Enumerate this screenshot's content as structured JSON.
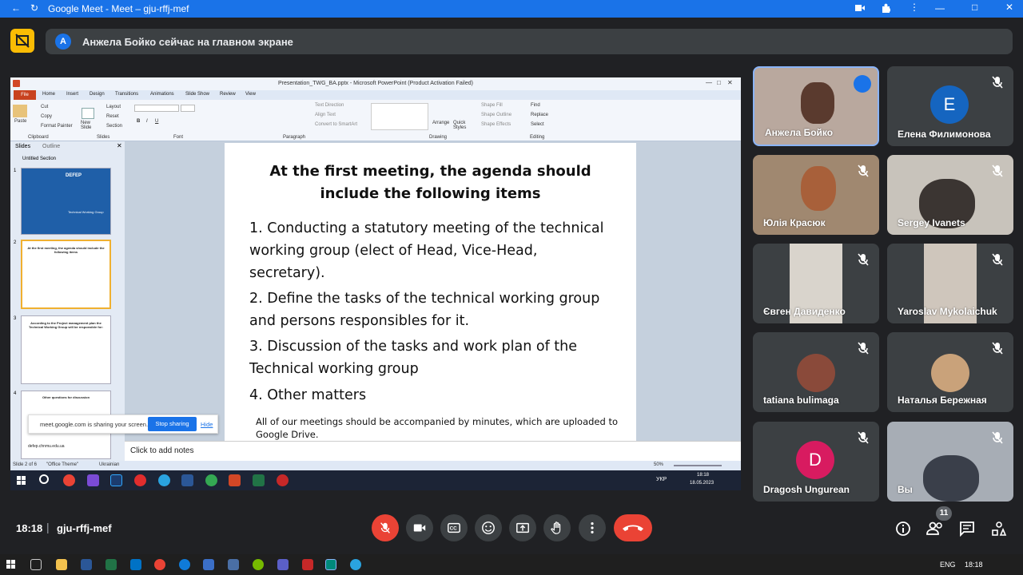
{
  "browser": {
    "window_title": "Google Meet - Meet – gju-rffj-mef"
  },
  "banner": {
    "avatar_letter": "A",
    "text": "Анжела Бойко сейчас на главном экране"
  },
  "powerpoint": {
    "title": "Presentation_TWG_BA.pptx - Microsoft PowerPoint (Product Activation Failed)",
    "file_tab": "File",
    "tabs": [
      "Home",
      "Insert",
      "Design",
      "Transitions",
      "Animations",
      "Slide Show",
      "Review",
      "View"
    ],
    "ribbon": {
      "paste": "Paste",
      "cut": "Cut",
      "copy": "Copy",
      "format_painter": "Format Painter",
      "clipboard": "Clipboard",
      "new_slide": "New Slide",
      "layout": "Layout",
      "reset": "Reset",
      "section": "Section",
      "slides": "Slides",
      "font": "Font",
      "paragraph": "Paragraph",
      "text_direction": "Text Direction",
      "align_text": "Align Text",
      "convert_smartart": "Convert to SmartArt",
      "arrange": "Arrange",
      "quick_styles": "Quick Styles",
      "shape_fill": "Shape Fill",
      "shape_outline": "Shape Outline",
      "shape_effects": "Shape Effects",
      "drawing": "Drawing",
      "find": "Find",
      "replace": "Replace",
      "select": "Select",
      "editing": "Editing"
    },
    "panel_tabs": [
      "Slides",
      "Outline"
    ],
    "section_name": "Untitled Section",
    "thumbnails": [
      {
        "num": "1",
        "title": "DEFEP",
        "subtitle": "Technical Working Group"
      },
      {
        "num": "2",
        "title": "At the first meeting, the agenda should include the following items"
      },
      {
        "num": "3",
        "title": "According to the Project management plan the Technical Working Group will be responsible for:"
      },
      {
        "num": "4",
        "title": "Other questions for discussion"
      }
    ],
    "slide": {
      "title": "At the first meeting, the agenda should include the following items",
      "items": [
        "1. Conducting a statutory meeting of the technical working group (elect of Head, Vice-Head, secretary).",
        "2. Define the tasks of the technical working group and persons responsibles for it.",
        "3. Discussion of the tasks and work plan of the Technical working group",
        "4. Other matters"
      ],
      "footnote": "All of our meetings should be accompanied by minutes, which are uploaded to Google Drive."
    },
    "notes_placeholder": "Click to add notes",
    "status_slide": "Slide 2 of 6",
    "status_theme": "\"Office Theme\"",
    "status_lang": "Ukrainian",
    "zoom": "50%",
    "inner_clock_time": "18:18",
    "inner_clock_date": "18.05.2023",
    "inner_lang": "УКР",
    "sharing_text": "meet.google.com is sharing your screen.",
    "stop_sharing": "Stop sharing",
    "hide": "Hide",
    "tooltip_url": "defep.chnmu.edu.ua"
  },
  "participants": [
    {
      "name": "Анжела Бойко",
      "speaking": true
    },
    {
      "name": "Елена Филимонова",
      "letter": "E",
      "color": "#1565c0"
    },
    {
      "name": "Юлія Красюк"
    },
    {
      "name": "Sergey Ivanets"
    },
    {
      "name": "Євген Давиденко"
    },
    {
      "name": "Yaroslav Mykolaichuk"
    },
    {
      "name": "tatiana bulimaga"
    },
    {
      "name": "Наталья Бережная"
    },
    {
      "name": "Dragosh Ungurean",
      "letter": "D",
      "color": "#d81b60"
    },
    {
      "name": "Вы"
    }
  ],
  "meeting": {
    "time": "18:18",
    "separator": "|",
    "code": "gju-rffj-mef",
    "people_count": "11"
  },
  "os": {
    "lang": "ENG",
    "time": "18:18"
  },
  "colors": {
    "meet_bg": "#202124",
    "tile_bg": "#3c4043",
    "end_call": "#ea4335",
    "browser_bar": "#1a73e8"
  }
}
